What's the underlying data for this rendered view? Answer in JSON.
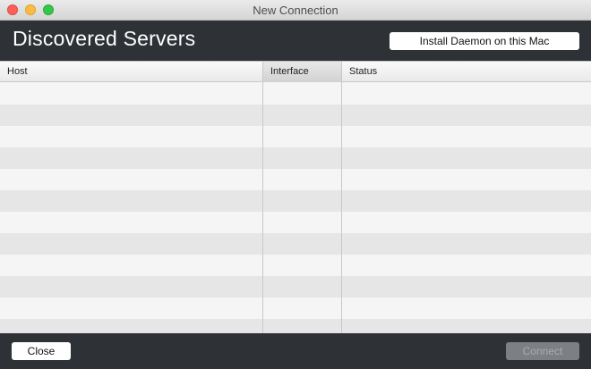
{
  "window": {
    "title": "New Connection"
  },
  "header": {
    "title": "Discovered Servers",
    "install_button_label": "Install Daemon on this Mac"
  },
  "table": {
    "columns": [
      {
        "label": "Host"
      },
      {
        "label": "Interface"
      },
      {
        "label": "Status"
      }
    ],
    "rows": []
  },
  "footer": {
    "close_label": "Close",
    "connect_label": "Connect",
    "connect_enabled": false
  },
  "colors": {
    "panel": "#2e3135",
    "row_alt": "#e6e6e6",
    "row": "#f5f5f5"
  }
}
